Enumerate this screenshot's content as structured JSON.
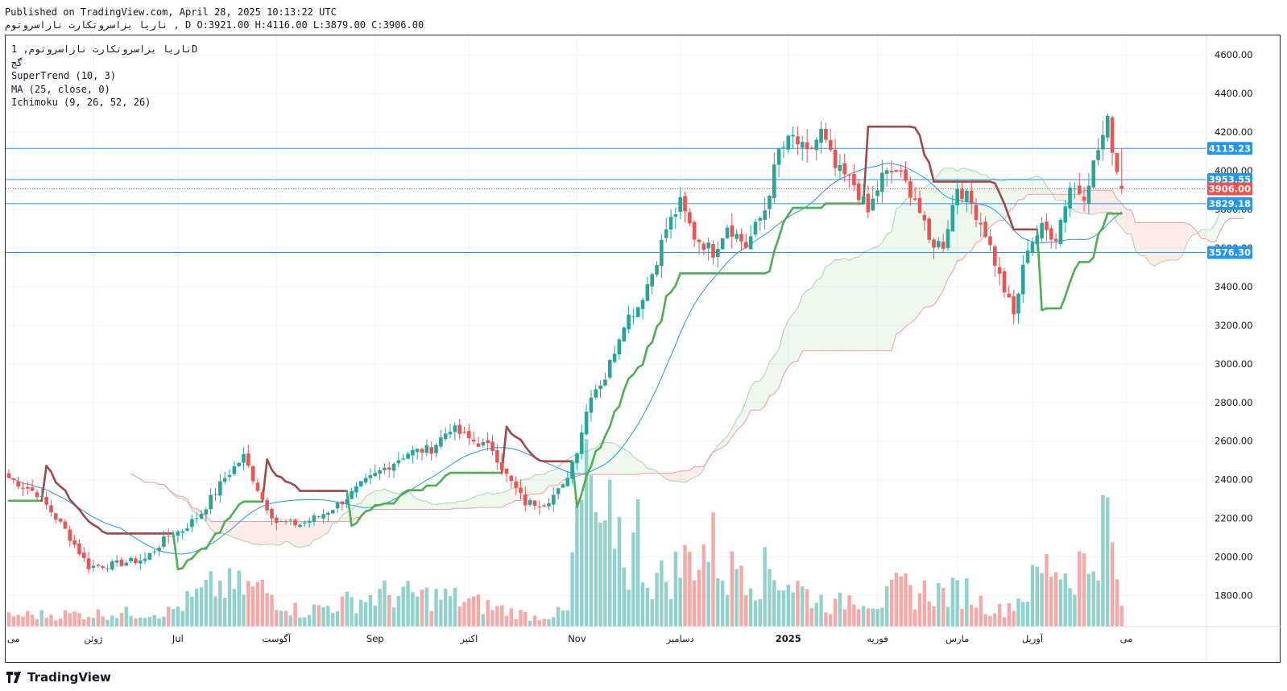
{
  "header": {
    "published": "Published on TradingView.com, April 28, 2025 10:13:22 UTC",
    "symbol_line": "ناریا بزاسروتکارت نازاسروتوم , D",
    "ohlc": "O:3921.00 H:4116.00 L:3879.00 C:3906.00"
  },
  "legend": {
    "symbol": "ناریا بزاسروتکارت نازاسروتوم, 1D",
    "sub": "گج",
    "supertrend": "SuperTrend (10, 3)",
    "ma": "MA (25, close, 0)",
    "ichimoku": "Ichimoku (9, 26, 52, 26)"
  },
  "footer": {
    "brand": "TradingView"
  },
  "colors": {
    "up": "#26a69a",
    "down": "#ef5350",
    "st_up": "#4caf50",
    "st_down": "#a04848",
    "ma": "#2196f3",
    "hline": "#2196f3",
    "price": "#ef5350"
  },
  "chart_data": {
    "type": "candlestick",
    "ylim": [
      1640,
      4700
    ],
    "y_ticks": [
      1800,
      2000,
      2200,
      2400,
      2600,
      2800,
      3000,
      3200,
      3400,
      3600,
      3800,
      4000,
      4200,
      4400,
      4600
    ],
    "x_labels": [
      {
        "label": "می",
        "i": 1
      },
      {
        "label": "ژوئن",
        "i": 18
      },
      {
        "label": "Jul",
        "i": 36
      },
      {
        "label": "آگوست",
        "i": 57
      },
      {
        "label": "Sep",
        "i": 78
      },
      {
        "label": "اکتبر",
        "i": 98
      },
      {
        "label": "Nov",
        "i": 121
      },
      {
        "label": "دسامبر",
        "i": 143
      },
      {
        "label": "2025",
        "i": 166
      },
      {
        "label": "فوریه",
        "i": 185
      },
      {
        "label": "مارس",
        "i": 202
      },
      {
        "label": "آوریل",
        "i": 218
      },
      {
        "label": "می",
        "i": 238
      }
    ],
    "price_labels": [
      {
        "value": 4115.23,
        "text": "4115.23",
        "kind": "line"
      },
      {
        "value": 3953.55,
        "text": "3953.55",
        "kind": "line"
      },
      {
        "value": 3906.0,
        "text": "3906.00",
        "kind": "price"
      },
      {
        "value": 3829.18,
        "text": "3829.18",
        "kind": "line"
      },
      {
        "value": 3576.3,
        "text": "3576.30",
        "kind": "line"
      }
    ],
    "close_anchors": [
      [
        0,
        2410
      ],
      [
        6,
        2330
      ],
      [
        12,
        2140
      ],
      [
        17,
        1950
      ],
      [
        22,
        1960
      ],
      [
        29,
        1990
      ],
      [
        34,
        2110
      ],
      [
        37,
        2140
      ],
      [
        41,
        2230
      ],
      [
        46,
        2410
      ],
      [
        50,
        2520
      ],
      [
        54,
        2300
      ],
      [
        57,
        2180
      ],
      [
        62,
        2170
      ],
      [
        66,
        2210
      ],
      [
        70,
        2270
      ],
      [
        75,
        2370
      ],
      [
        80,
        2460
      ],
      [
        85,
        2540
      ],
      [
        90,
        2560
      ],
      [
        94,
        2670
      ],
      [
        98,
        2610
      ],
      [
        103,
        2560
      ],
      [
        106,
        2420
      ],
      [
        110,
        2280
      ],
      [
        114,
        2280
      ],
      [
        118,
        2360
      ],
      [
        121,
        2560
      ],
      [
        124,
        2850
      ],
      [
        127,
        2930
      ],
      [
        131,
        3220
      ],
      [
        134,
        3300
      ],
      [
        137,
        3470
      ],
      [
        140,
        3700
      ],
      [
        143,
        3830
      ],
      [
        146,
        3660
      ],
      [
        150,
        3580
      ],
      [
        153,
        3720
      ],
      [
        157,
        3610
      ],
      [
        161,
        3800
      ],
      [
        164,
        4100
      ],
      [
        167,
        4170
      ],
      [
        170,
        4080
      ],
      [
        173,
        4200
      ],
      [
        176,
        4010
      ],
      [
        180,
        3930
      ],
      [
        183,
        3780
      ],
      [
        186,
        3970
      ],
      [
        189,
        4000
      ],
      [
        193,
        3860
      ],
      [
        196,
        3630
      ],
      [
        199,
        3620
      ],
      [
        202,
        3920
      ],
      [
        205,
        3830
      ],
      [
        208,
        3680
      ],
      [
        211,
        3450
      ],
      [
        214,
        3250
      ],
      [
        217,
        3610
      ],
      [
        220,
        3700
      ],
      [
        223,
        3660
      ],
      [
        226,
        3920
      ],
      [
        229,
        3880
      ],
      [
        232,
        4110
      ],
      [
        234,
        4250
      ],
      [
        236,
        4000
      ],
      [
        237,
        3906
      ]
    ],
    "volume_heights": [
      [
        0,
        14
      ],
      [
        20,
        16
      ],
      [
        34,
        18
      ],
      [
        44,
        50
      ],
      [
        54,
        46
      ],
      [
        62,
        18
      ],
      [
        80,
        40
      ],
      [
        94,
        36
      ],
      [
        112,
        12
      ],
      [
        119,
        18
      ],
      [
        121,
        130
      ],
      [
        124,
        180
      ],
      [
        126,
        90
      ],
      [
        129,
        140
      ],
      [
        132,
        75
      ],
      [
        134,
        120
      ],
      [
        136,
        60
      ],
      [
        140,
        60
      ],
      [
        143,
        75
      ],
      [
        146,
        90
      ],
      [
        150,
        100
      ],
      [
        153,
        60
      ],
      [
        156,
        85
      ],
      [
        159,
        60
      ],
      [
        162,
        70
      ],
      [
        165,
        60
      ],
      [
        168,
        50
      ],
      [
        170,
        40
      ],
      [
        176,
        25
      ],
      [
        180,
        40
      ],
      [
        186,
        30
      ],
      [
        190,
        50
      ],
      [
        193,
        40
      ],
      [
        196,
        45
      ],
      [
        200,
        40
      ],
      [
        204,
        45
      ],
      [
        207,
        30
      ],
      [
        211,
        20
      ],
      [
        214,
        30
      ],
      [
        217,
        45
      ],
      [
        220,
        70
      ],
      [
        223,
        80
      ],
      [
        226,
        60
      ],
      [
        228,
        80
      ],
      [
        230,
        70
      ],
      [
        232,
        110
      ],
      [
        234,
        135
      ],
      [
        236,
        50
      ],
      [
        237,
        30
      ]
    ],
    "series": [
      {
        "name": "SuperTrend (10, 3)"
      },
      {
        "name": "MA (25, close, 0)"
      },
      {
        "name": "Ichimoku (9, 26, 52, 26)"
      }
    ]
  }
}
